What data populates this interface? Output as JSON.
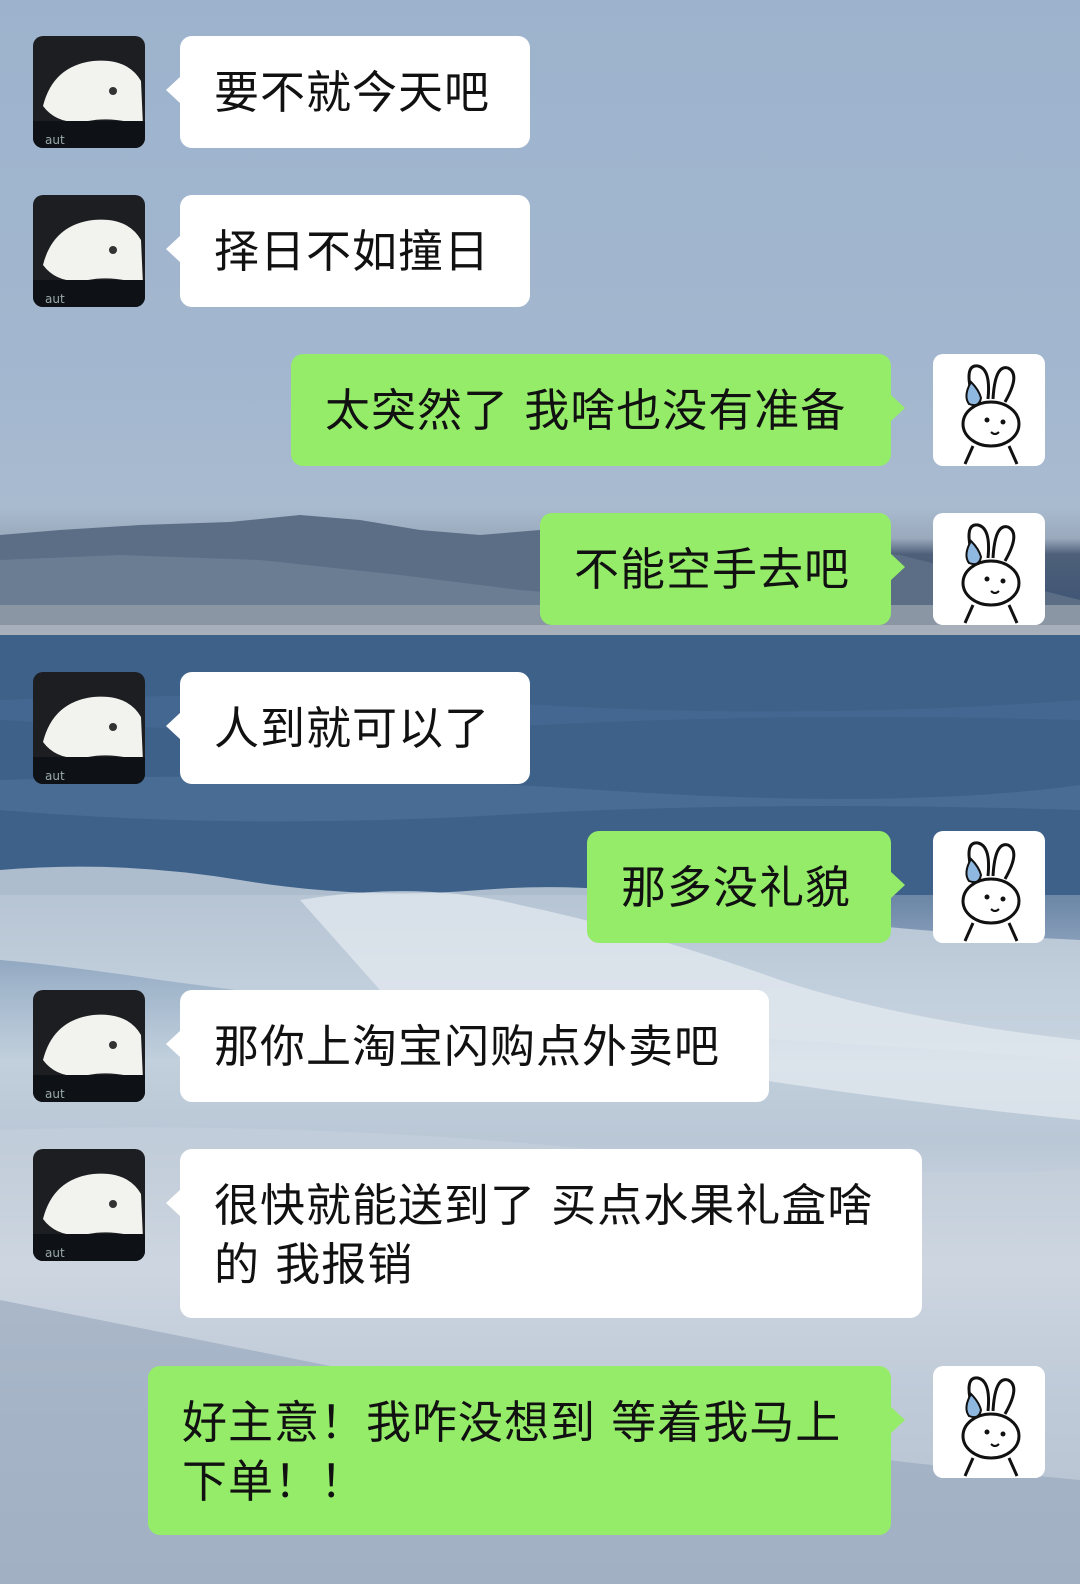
{
  "colors": {
    "incoming_bubble": "#ffffff",
    "outgoing_bubble": "#95ec69",
    "text": "#111111"
  },
  "avatars": {
    "contact": "cat-avatar",
    "me": "bunny-sweat-avatar"
  },
  "messages": [
    {
      "side": "left",
      "text": "要不就今天吧"
    },
    {
      "side": "left",
      "text": "择日不如撞日"
    },
    {
      "side": "right",
      "text": "太突然了 我啥也没有准备"
    },
    {
      "side": "right",
      "text": "不能空手去吧"
    },
    {
      "side": "left",
      "text": "人到就可以了"
    },
    {
      "side": "right",
      "text": "那多没礼貌"
    },
    {
      "side": "left",
      "text": "那你上淘宝闪购点外卖吧"
    },
    {
      "side": "left",
      "text": "很快就能送到了 买点水果礼盒啥的 我报销"
    },
    {
      "side": "right",
      "text": "好主意！我咋没想到 等着我马上下单！！"
    }
  ]
}
